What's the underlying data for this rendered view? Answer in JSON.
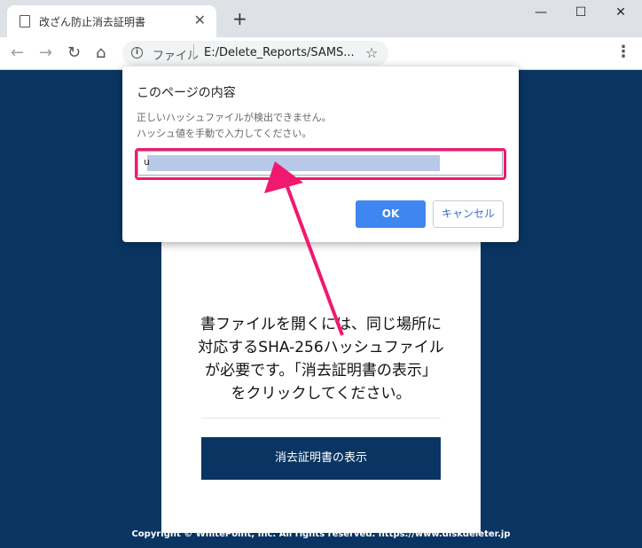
{
  "browser": {
    "tab_title": "改ざん防止消去証明書",
    "tab_close": "✕",
    "new_tab": "+",
    "window_controls": {
      "minimize": "—",
      "maximize": "☐",
      "close": "✕"
    },
    "nav": {
      "back": "←",
      "forward": "→",
      "reload": "↻",
      "home": "⌂"
    },
    "address": {
      "scheme_label": "ファイル",
      "url": "E:/Delete_Reports/SAMS..."
    },
    "bookmark_icon": "☆",
    "menu_icon": "⋮"
  },
  "dialog": {
    "title": "このページの内容",
    "message_line1": "正しいハッシュファイルが検出できません。",
    "message_line2": "ハッシュ値を手動で入力してください。",
    "input_value": "u",
    "ok_label": "OK",
    "cancel_label": "キャンセル"
  },
  "card": {
    "line1": "書ファイルを開くには、同じ場所に",
    "line2": "対応するSHA-256ハッシュファイル",
    "line3": "が必要です。「消去証明書の表示」",
    "line4": "をクリックしてください。",
    "button_label": "消去証明書の表示"
  },
  "footer": {
    "copyright": "Copyright © WhitePoint, Inc. All rights reserved. https://www.diskdeleter.jp"
  },
  "colors": {
    "page_bg": "#0a3563",
    "highlight": "#f0196f",
    "ok_button": "#3f86f1"
  }
}
